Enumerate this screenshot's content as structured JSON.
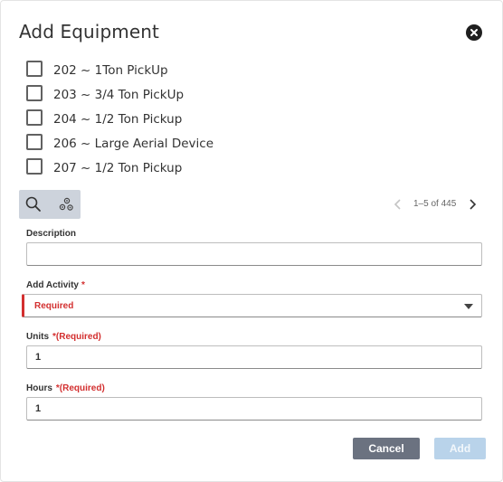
{
  "dialog": {
    "title": "Add Equipment"
  },
  "equipment_list": [
    {
      "label": "202 ~ 1Ton PickUp",
      "checked": false
    },
    {
      "label": "203 ~ 3/4 Ton PickUp",
      "checked": false
    },
    {
      "label": "204 ~ 1/2 Ton Pickup",
      "checked": false
    },
    {
      "label": "206 ~ Large Aerial Device",
      "checked": false
    },
    {
      "label": "207 ~ 1/2 Ton Pickup",
      "checked": false
    }
  ],
  "toolbar": {
    "search_icon": "search-icon",
    "settings_icon": "gears-icon"
  },
  "pager": {
    "range_text": "1–5 of 445"
  },
  "form": {
    "description": {
      "label": "Description",
      "value": ""
    },
    "activity": {
      "label": "Add Activity",
      "required_marker": "*",
      "selected": "Required"
    },
    "units": {
      "label": "Units",
      "required_marker": "*(Required)",
      "value": "1"
    },
    "hours": {
      "label": "Hours",
      "required_marker": "*(Required)",
      "value": "1"
    }
  },
  "actions": {
    "cancel_label": "Cancel",
    "add_label": "Add"
  },
  "colors": {
    "required_red": "#d32f2f",
    "cancel_bg": "#6b7280",
    "add_disabled_bg": "#b9d3ea",
    "toolbar_bg": "#cdd3dc"
  }
}
